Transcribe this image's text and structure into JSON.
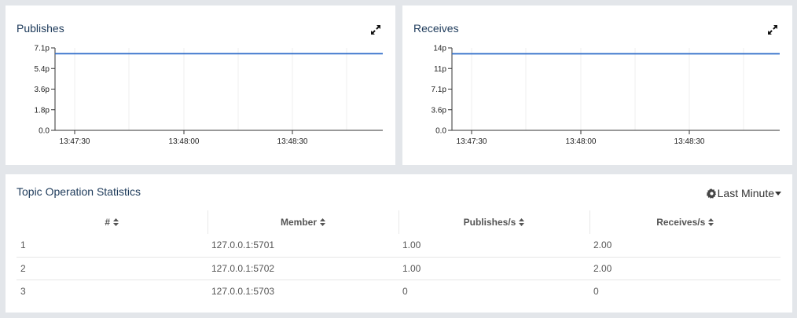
{
  "publishes": {
    "title": "Publishes",
    "chart_data": {
      "type": "line",
      "title": "Publishes",
      "x_ticks": [
        "13:47:30",
        "13:48:00",
        "13:48:30"
      ],
      "y_ticks": [
        "0.0",
        "1.8p",
        "3.6p",
        "5.4p",
        "7.1p"
      ],
      "ylim": [
        0,
        7.1
      ],
      "series": [
        {
          "values": [
            6.6,
            6.6
          ]
        }
      ],
      "line_color": "#2e6bc9"
    }
  },
  "receives": {
    "title": "Receives",
    "chart_data": {
      "type": "line",
      "title": "Receives",
      "x_ticks": [
        "13:47:30",
        "13:48:00",
        "13:48:30"
      ],
      "y_ticks": [
        "0.0",
        "3.6p",
        "7.1p",
        "11p",
        "14p"
      ],
      "ylim": [
        0,
        14
      ],
      "series": [
        {
          "values": [
            13,
            13
          ]
        }
      ],
      "line_color": "#2e6bc9"
    }
  },
  "stats": {
    "title": "Topic Operation Statistics",
    "range_label": "Last Minute",
    "columns": [
      "#",
      "Member",
      "Publishes/s",
      "Receives/s"
    ],
    "rows": [
      [
        "1",
        "127.0.0.1:5701",
        "1.00",
        "2.00"
      ],
      [
        "2",
        "127.0.0.1:5702",
        "1.00",
        "2.00"
      ],
      [
        "3",
        "127.0.0.1:5703",
        "0",
        "0"
      ]
    ]
  },
  "icons": {
    "expand": "expand-icon",
    "gear": "gear-icon",
    "sort": "sort-icon",
    "caret": "caret-down-icon"
  }
}
